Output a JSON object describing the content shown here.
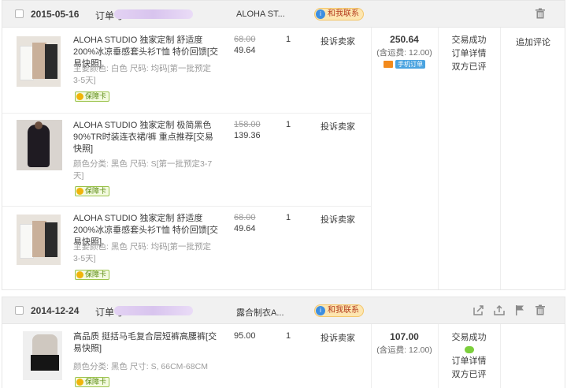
{
  "orders": [
    {
      "date": "2015-05-16",
      "order_label": "订单号:",
      "shop": "ALOHA ST...",
      "contact": "和我联系",
      "items": [
        {
          "title": "ALOHA STUDIO 独家定制 舒适度200%冰凉垂感套头衫T恤 特价回馈[交易快照]",
          "attr": "主要颜色: 白色  尺码: 均码[第一批预定3-5天]",
          "badge": "保障卡",
          "old_price": "68.00",
          "price": "49.64",
          "qty": "1",
          "complain": "投诉卖家"
        },
        {
          "title": "ALOHA STUDIO 独家定制 极简黑色90%TR时装连衣裙/裤 重点推荐[交易快照]",
          "attr": "颜色分类: 黑色  尺码: S[第一批预定3-7天]",
          "badge": "保障卡",
          "old_price": "158.00",
          "price": "139.36",
          "qty": "1",
          "complain": "投诉卖家"
        },
        {
          "title": "ALOHA STUDIO 独家定制 舒适度200%冰凉垂感套头衫T恤 特价回馈[交易快照]",
          "attr": "主要颜色: 黑色  尺码: 均码[第一批预定3-5天]",
          "badge": "保障卡",
          "old_price": "68.00",
          "price": "49.64",
          "qty": "1",
          "complain": "投诉卖家"
        }
      ],
      "total": "250.64",
      "shipping": "(含运费: 12.00)",
      "mobile_badge": "手机订单",
      "status": [
        "交易成功",
        "订单详情",
        "双方已评"
      ],
      "action": "追加评论"
    },
    {
      "date": "2014-12-24",
      "order_label": "订单号:",
      "shop": "露合制衣A...",
      "contact": "和我联系",
      "items": [
        {
          "title": "高品质 挺括马毛复合层短裤高腰裤[交易快照]",
          "attr": "颜色分类: 黑色  尺寸: S, 66CM-68CM",
          "badge": "保障卡",
          "price": "95.00",
          "qty": "1",
          "complain": "投诉卖家"
        }
      ],
      "total": "107.00",
      "shipping": "(含运费: 12.00)",
      "status": [
        "交易成功",
        "订单详情",
        "双方已评"
      ]
    }
  ],
  "icons": {
    "delete": "trash-icon",
    "share": "share-icon",
    "upload": "upload-icon",
    "flag": "flag-icon",
    "contact": "chat-icon",
    "guarantee": "coin-icon",
    "mobile": "phone-icon",
    "wechat": "wechat-icon"
  },
  "colors": {
    "header_bg": "#f1f1f1",
    "contact_bg": "#fde6b0",
    "contact_text": "#b43c1e",
    "badge_border": "#9bc34b",
    "mobile_badge": "#4aa3e0"
  }
}
